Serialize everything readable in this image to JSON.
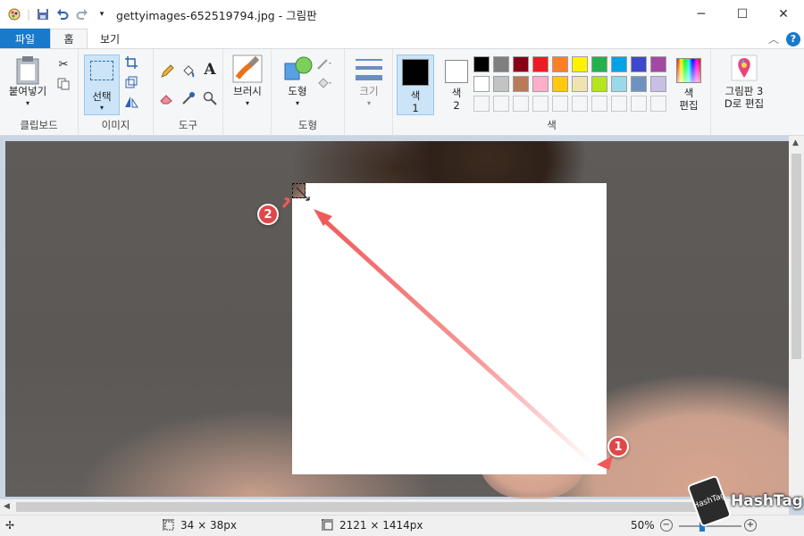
{
  "window": {
    "title": "gettyimages-652519794.jpg - 그림판",
    "minimize": "─",
    "maximize": "☐",
    "close": "✕"
  },
  "quick_access": {
    "icons": [
      "paint-app-icon",
      "save-icon",
      "undo-icon",
      "redo-icon",
      "customize-dropdown-icon"
    ]
  },
  "tabs": [
    "파일",
    "홈",
    "보기"
  ],
  "tab_right": {
    "collapse": "︿",
    "help": "?"
  },
  "ribbon": {
    "clipboard": {
      "paste": "붙여넣기",
      "label": "클립보드"
    },
    "image": {
      "select": "선택",
      "label": "이미지"
    },
    "tools": {
      "label": "도구"
    },
    "brushes": {
      "label": "브러시"
    },
    "shapes": {
      "shapes": "도형",
      "label": "도형"
    },
    "size": {
      "label": "크기"
    },
    "colors": {
      "color1": "색\n1",
      "color1_a": "색",
      "color1_b": "1",
      "color2_a": "색",
      "color2_b": "2",
      "edit_a": "색",
      "edit_b": "편집",
      "label": "색",
      "color1_value": "#000000",
      "color2_value": "#ffffff",
      "palette": [
        "#000000",
        "#7f7f7f",
        "#880015",
        "#ed1c24",
        "#ff7f27",
        "#fff200",
        "#22b14c",
        "#00a2e8",
        "#3f48cc",
        "#a349a4",
        "#ffffff",
        "#c3c3c3",
        "#b97a57",
        "#ffaec9",
        "#ffc90e",
        "#efe4b0",
        "#b5e61d",
        "#99d9ea",
        "#7092be",
        "#c8bfe7",
        "#f5f6f7",
        "#f5f6f7",
        "#f5f6f7",
        "#f5f6f7",
        "#f5f6f7",
        "#f5f6f7",
        "#f5f6f7",
        "#f5f6f7",
        "#f5f6f7",
        "#f5f6f7"
      ]
    },
    "paint3d": {
      "line1": "그림판 3",
      "line2": "D로 편집"
    }
  },
  "annotations": {
    "badge1": "1",
    "badge2": "2"
  },
  "status": {
    "selection_size": "34 × 38px",
    "image_size": "2121 × 1414px",
    "zoom": "50%"
  },
  "watermark": {
    "text": "HashTag",
    "mark": "HashTag"
  }
}
